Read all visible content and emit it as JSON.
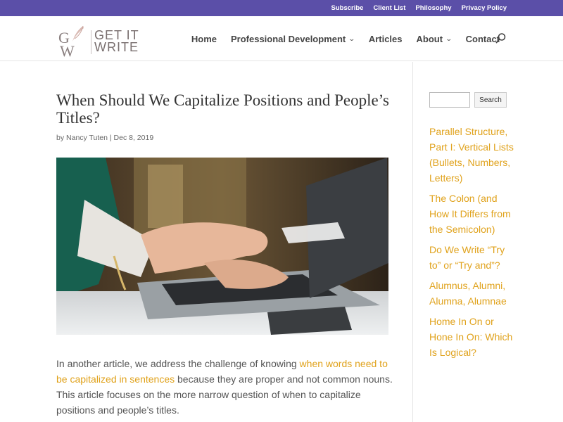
{
  "topbar": {
    "links": [
      "Subscribe",
      "Client List",
      "Philosophy",
      "Privacy Policy"
    ]
  },
  "logo": {
    "line1": "GET IT",
    "line2": "WRITE"
  },
  "nav": {
    "home": "Home",
    "professional_development": "Professional Development",
    "articles": "Articles",
    "about": "About",
    "contact": "Contact"
  },
  "post": {
    "title": "When Should We Capitalize Positions and People’s Titles?",
    "author_prefix": "by ",
    "author": "Nancy Tuten",
    "separator": " | ",
    "date": "Dec 8, 2019",
    "intro_before": "In another article, we address the challenge of knowing ",
    "intro_link": "when words need to be capitalized in sentences",
    "intro_after": " because they are proper and not common nouns. This article focuses on the more narrow question of when to capitalize positions and people’s titles."
  },
  "sidebar": {
    "search_button": "Search",
    "recent_posts": [
      "Parallel Structure, Part I: Vertical Lists (Bullets, Numbers, Letters)",
      "The Colon (and How It Differs from the Semicolon)",
      "Do We Write “Try to” or “Try and”?",
      "Alumnus, Alumni, Alumna, Alumnae",
      "Home In On or Hone In On: Which Is Logical?"
    ]
  },
  "colors": {
    "topbar": "#5b4fa8",
    "link_accent": "#e0a21b",
    "nav_text": "#444444"
  }
}
